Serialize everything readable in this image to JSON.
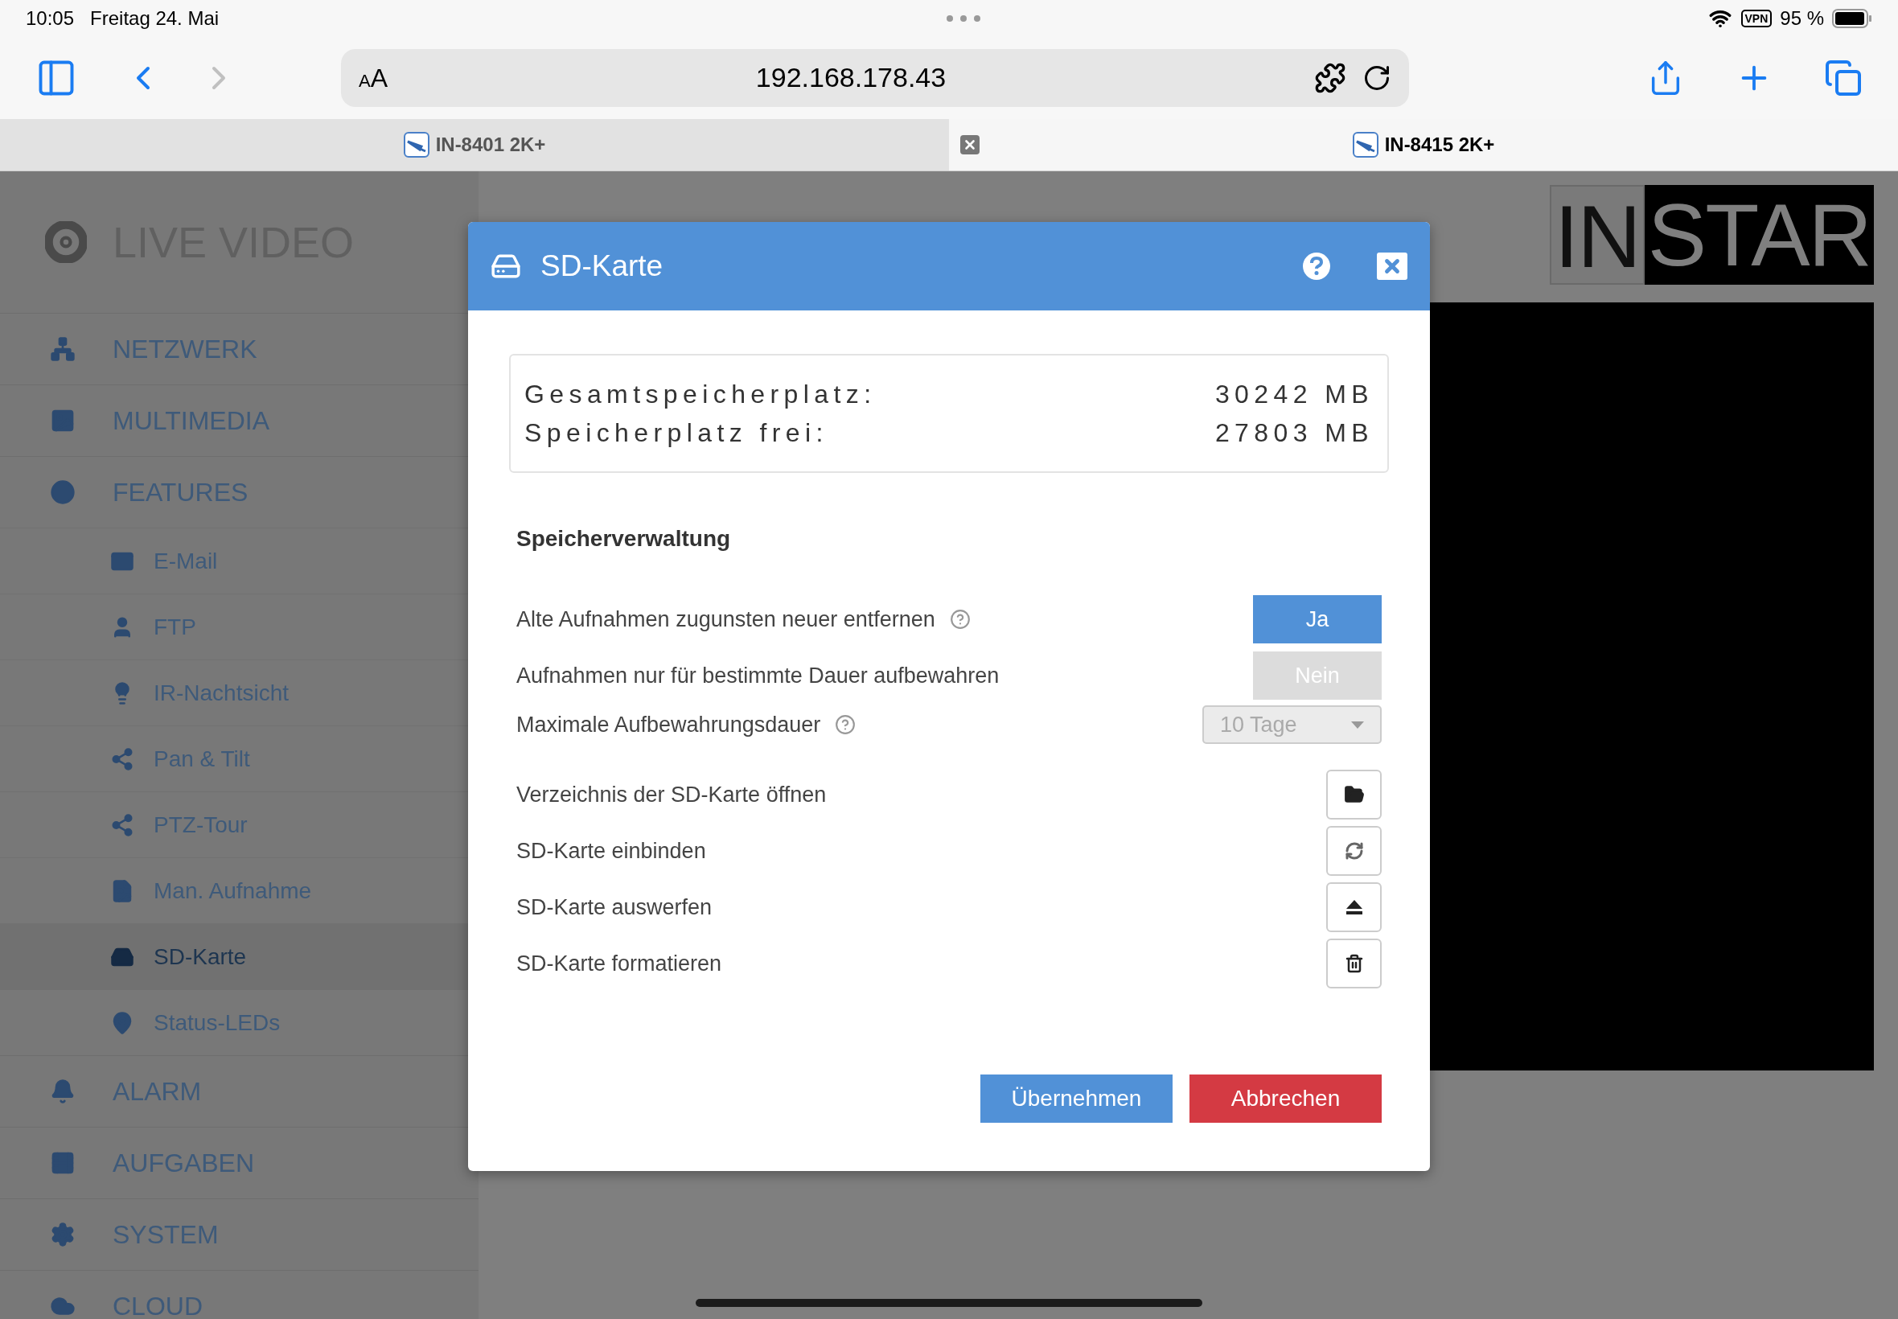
{
  "status_bar": {
    "time": "10:05",
    "date": "Freitag 24. Mai",
    "vpn": "VPN",
    "battery": "95 %"
  },
  "browser": {
    "text_size": "AA",
    "url": "192.168.178.43"
  },
  "tabs": [
    {
      "title": "IN-8401 2K+",
      "selected": false
    },
    {
      "title": "IN-8415 2K+",
      "selected": true
    }
  ],
  "sidebar": {
    "title": "LIVE VIDEO",
    "items": [
      {
        "label": "NETZWERK",
        "selected": false
      },
      {
        "label": "MULTIMEDIA",
        "selected": false
      },
      {
        "label": "FEATURES",
        "selected": false,
        "children": [
          {
            "label": "E-Mail",
            "selected": false
          },
          {
            "label": "FTP",
            "selected": false
          },
          {
            "label": "IR-Nachtsicht",
            "selected": false
          },
          {
            "label": "Pan & Tilt",
            "selected": false
          },
          {
            "label": "PTZ-Tour",
            "selected": false
          },
          {
            "label": "Man. Aufnahme",
            "selected": false
          },
          {
            "label": "SD-Karte",
            "selected": true
          },
          {
            "label": "Status-LEDs",
            "selected": false
          }
        ]
      },
      {
        "label": "ALARM",
        "selected": false
      },
      {
        "label": "AUFGABEN",
        "selected": false
      },
      {
        "label": "SYSTEM",
        "selected": false
      },
      {
        "label": "CLOUD",
        "selected": false
      }
    ]
  },
  "logo": {
    "parts": [
      "IN",
      "STAR"
    ]
  },
  "dialog": {
    "title": "SD-Karte",
    "storage": [
      {
        "label": "Gesamtspeicherplatz:",
        "value": "30242 MB"
      },
      {
        "label": "Speicherplatz frei:",
        "value": "27803 MB"
      }
    ],
    "section_title": "Speicherverwaltung",
    "settings": [
      {
        "kind": "toggle",
        "label": "Alte Aufnahmen zugunsten neuer entfernen",
        "help": true,
        "value": "Ja",
        "selected": true
      },
      {
        "kind": "toggle",
        "label": "Aufnahmen nur für bestimmte Dauer aufbewahren",
        "help": false,
        "value": "Nein",
        "selected": false
      },
      {
        "kind": "select",
        "label": "Maximale Aufbewahrungsdauer",
        "help": true,
        "value": "10 Tage",
        "disabled": true
      },
      {
        "kind": "open",
        "label": "Verzeichnis der SD-Karte öffnen",
        "help": false
      },
      {
        "kind": "mount",
        "label": "SD-Karte einbinden",
        "help": false
      },
      {
        "kind": "eject",
        "label": "SD-Karte auswerfen",
        "help": false
      },
      {
        "kind": "format",
        "label": "SD-Karte formatieren",
        "help": false
      }
    ],
    "buttons": [
      {
        "kind": "primary",
        "label": "Übernehmen"
      },
      {
        "kind": "danger",
        "label": "Abbrechen"
      }
    ]
  }
}
